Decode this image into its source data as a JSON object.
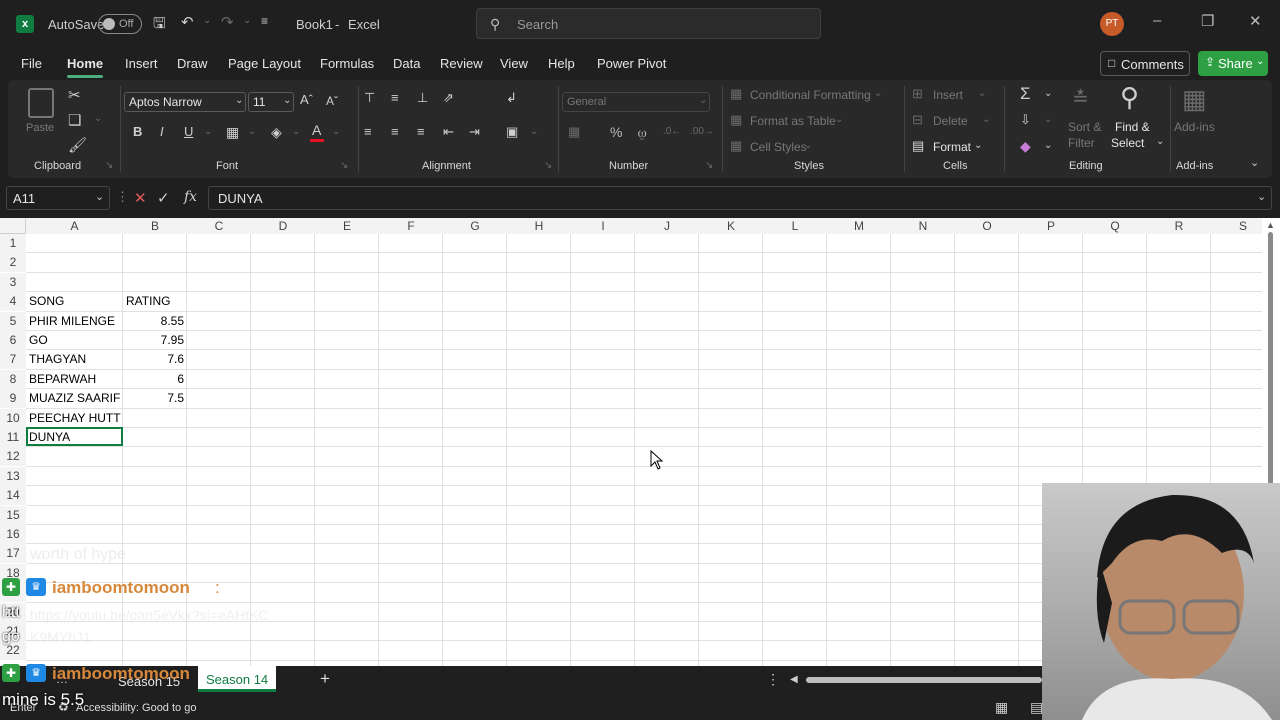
{
  "titlebar": {
    "autosave_label": "AutoSave",
    "autosave_state": "Off",
    "doc_title": "Book1",
    "app_name": "Excel",
    "search_placeholder": "Search",
    "user_initials": "PT"
  },
  "tabs": [
    "File",
    "Home",
    "Insert",
    "Draw",
    "Page Layout",
    "Formulas",
    "Data",
    "Review",
    "View",
    "Help",
    "Power Pivot"
  ],
  "actions": {
    "comments": "Comments",
    "share": "Share"
  },
  "ribbon": {
    "clipboard": {
      "label": "Clipboard",
      "paste": "Paste"
    },
    "font": {
      "label": "Font",
      "font_name": "Aptos Narrow",
      "font_size": "11"
    },
    "alignment": {
      "label": "Alignment"
    },
    "number": {
      "label": "Number",
      "format": "General"
    },
    "styles": {
      "label": "Styles",
      "conditional": "Conditional Formatting",
      "table": "Format as Table",
      "cell_styles": "Cell Styles"
    },
    "cells": {
      "label": "Cells",
      "insert": "Insert",
      "delete": "Delete",
      "format": "Format"
    },
    "editing": {
      "label": "Editing",
      "sort": "Sort &",
      "filter": "Filter",
      "find": "Find &",
      "select": "Select"
    },
    "addins": {
      "label": "Add-ins",
      "btn": "Add-ins"
    }
  },
  "formula_bar": {
    "name_box": "A11",
    "fx": "fx",
    "content": "DUNYA"
  },
  "columns": [
    "A",
    "B",
    "C",
    "D",
    "E",
    "F",
    "G",
    "H",
    "I",
    "J",
    "K",
    "L",
    "M",
    "N",
    "O",
    "P",
    "Q",
    "R",
    "S"
  ],
  "rows": [
    "1",
    "2",
    "3",
    "4",
    "5",
    "6",
    "7",
    "8",
    "9",
    "10",
    "11",
    "12",
    "13",
    "14",
    "15",
    "16",
    "17",
    "18",
    "19",
    "20",
    "21",
    "22"
  ],
  "cells": {
    "A4": "SONG",
    "B4": "RATING",
    "A5": "PHIR MILENGE",
    "B5": "8.55",
    "A6": "GO",
    "B6": "7.95",
    "A7": "THAGYAN",
    "B7": "7.6",
    "A8": "BEPARWAH",
    "B8": "6",
    "A9": "MUAZIZ SAARIF",
    "B9": "7.5",
    "A10": "PEECHAY HUTT",
    "A11": "DUNYA"
  },
  "sheets": [
    "Season 15",
    "Season 14"
  ],
  "active_sheet": "Season 14",
  "status": {
    "mode": "Enter",
    "accessibility": "Accessibility: Good to go"
  },
  "overlay_chat": {
    "faded_line": "worth of hype",
    "messages": [
      {
        "user": "iamboomtomoon",
        "text": "https://youtu.be/pan5eVkx?si=eAHtKCK9MYhJ1"
      },
      {
        "user": "iamboomtomoon",
        "text": "mine is 5.5"
      }
    ],
    "link_partial_1": "htt",
    "link_partial_2": "go"
  },
  "colors": {
    "accent_green": "#107c41",
    "share_green": "#2ea043",
    "font_red": "#e81123",
    "avatar": "#c75b2a",
    "chat_user": "#d7883a"
  }
}
